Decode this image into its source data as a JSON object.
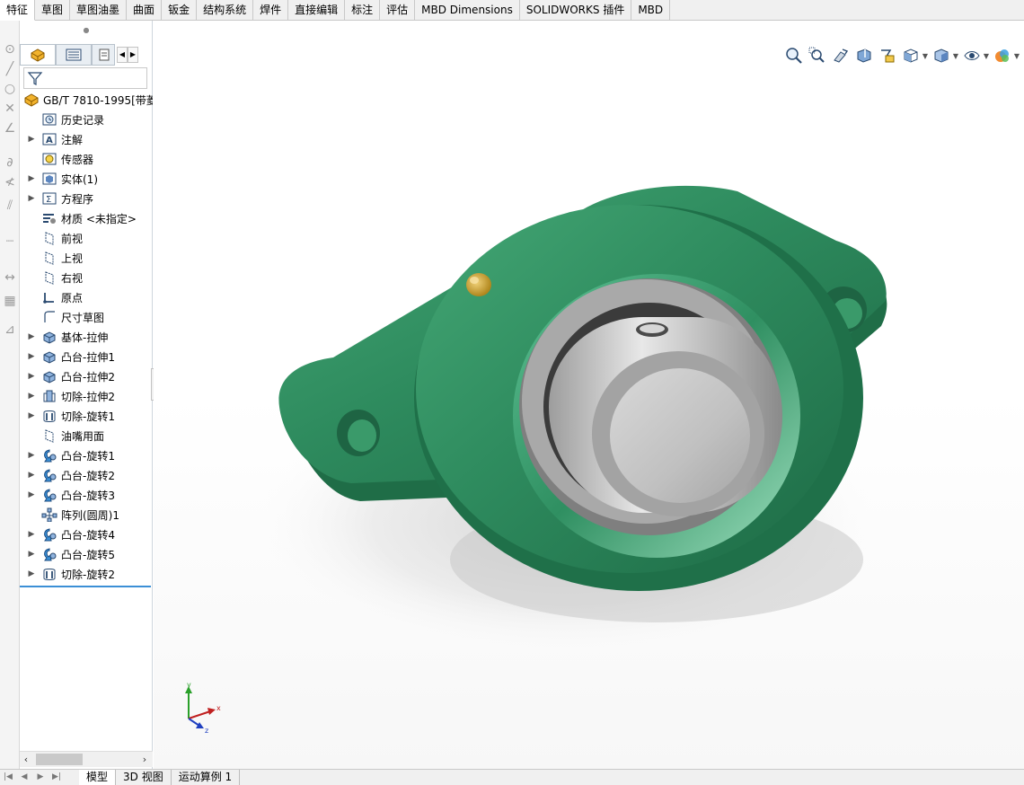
{
  "tabs": [
    {
      "label": "特征",
      "active": true
    },
    {
      "label": "草图",
      "active": false
    },
    {
      "label": "草图油墨",
      "active": false
    },
    {
      "label": "曲面",
      "active": false
    },
    {
      "label": "钣金",
      "active": false
    },
    {
      "label": "结构系统",
      "active": false
    },
    {
      "label": "焊件",
      "active": false
    },
    {
      "label": "直接编辑",
      "active": false
    },
    {
      "label": "标注",
      "active": false
    },
    {
      "label": "评估",
      "active": false
    },
    {
      "label": "MBD Dimensions",
      "active": false
    },
    {
      "label": "SOLIDWORKS 插件",
      "active": false
    },
    {
      "label": "MBD",
      "active": false
    }
  ],
  "feature_tree": {
    "root": {
      "label": "GB/T 7810-1995[带菱",
      "icon": "part-icon"
    },
    "items": [
      {
        "label": "历史记录",
        "icon": "history-icon",
        "expandable": false
      },
      {
        "label": "注解",
        "icon": "annotation-icon",
        "expandable": true
      },
      {
        "label": "传感器",
        "icon": "sensor-icon",
        "expandable": false
      },
      {
        "label": "实体(1)",
        "icon": "solid-body-icon",
        "expandable": true
      },
      {
        "label": "方程序",
        "icon": "equation-icon",
        "expandable": true
      },
      {
        "label": "材质 <未指定>",
        "icon": "material-icon",
        "expandable": false
      },
      {
        "label": "前视",
        "icon": "plane-icon",
        "expandable": false
      },
      {
        "label": "上视",
        "icon": "plane-icon",
        "expandable": false
      },
      {
        "label": "右视",
        "icon": "plane-icon",
        "expandable": false
      },
      {
        "label": "原点",
        "icon": "origin-icon",
        "expandable": false
      },
      {
        "label": "尺寸草图",
        "icon": "sketch-icon",
        "expandable": false
      },
      {
        "label": "基体-拉伸",
        "icon": "extrude-icon",
        "expandable": true
      },
      {
        "label": "凸台-拉伸1",
        "icon": "extrude-icon",
        "expandable": true
      },
      {
        "label": "凸台-拉伸2",
        "icon": "extrude-icon",
        "expandable": true
      },
      {
        "label": "切除-拉伸2",
        "icon": "cut-extrude-icon",
        "expandable": true
      },
      {
        "label": "切除-旋转1",
        "icon": "cut-revolve-icon",
        "expandable": true
      },
      {
        "label": "油嘴用面",
        "icon": "plane-icon",
        "expandable": false
      },
      {
        "label": "凸台-旋转1",
        "icon": "revolve-icon",
        "expandable": true
      },
      {
        "label": "凸台-旋转2",
        "icon": "revolve-icon",
        "expandable": true
      },
      {
        "label": "凸台-旋转3",
        "icon": "revolve-icon",
        "expandable": true
      },
      {
        "label": "阵列(圆周)1",
        "icon": "circular-pattern-icon",
        "expandable": false
      },
      {
        "label": "凸台-旋转4",
        "icon": "revolve-icon",
        "expandable": true
      },
      {
        "label": "凸台-旋转5",
        "icon": "revolve-icon",
        "expandable": true
      },
      {
        "label": "切除-旋转2",
        "icon": "cut-revolve-icon",
        "expandable": true
      }
    ]
  },
  "bottom_tabs": [
    {
      "label": "模型",
      "active": true
    },
    {
      "label": "3D 视图",
      "active": false
    },
    {
      "label": "运动算例 1",
      "active": false
    }
  ],
  "heads_up_toolbar": [
    "zoom-to-fit-icon",
    "zoom-to-area-icon",
    "previous-view-icon",
    "section-view-icon",
    "dynamic-annotation-icon",
    "view-orientation-icon",
    "display-style-icon",
    "hide-show-items-icon",
    "edit-appearance-icon"
  ],
  "triad": {
    "x": "x",
    "y": "y",
    "z": "z"
  },
  "colors": {
    "housing": "#2e8b5e",
    "housing_dark": "#1f6b46",
    "bearing_gray": "#9a9a9a",
    "accent": "#3b8fd6"
  }
}
